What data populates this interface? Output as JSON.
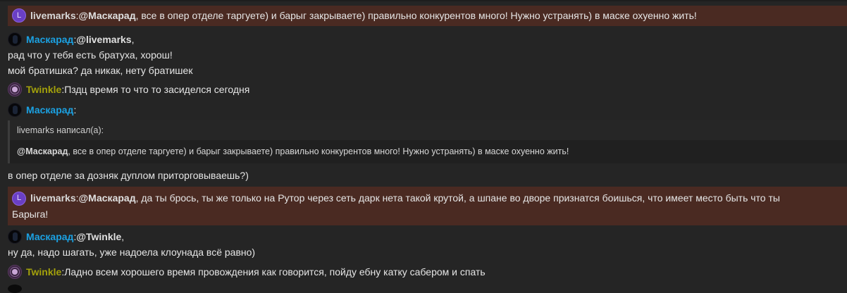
{
  "messages": [
    {
      "author": "livemarks",
      "avatar_letter": "L",
      "mention": "@Маскарад",
      "text": ", все в опер отделе таргуете) и барыг закрываете) правильно конкурентов много! Нужно устранять) в маске охуенно жить!"
    },
    {
      "author": "Маскарад",
      "mention": "@livemarks",
      "after": ",",
      "lines": [
        "рад что у тебя есть братуха, хорош!",
        "мой братишка? да никак, нету братишек"
      ]
    },
    {
      "author": "Twinkle",
      "text": "Пздц время то что то засиделся сегодня"
    },
    {
      "author": "Маскарад",
      "after": ":"
    },
    {
      "author": "livemarks",
      "avatar_letter": "L",
      "mention": "@Маскарад",
      "text_line1": ", да ты брось, ты же только на Рутор через сеть дарк нета такой крутой, а шпане во дворе признатся боишься, что имеет место быть что ты",
      "text_line2": "Барыга!"
    },
    {
      "author": "Маскарад",
      "mention": "@Twinkle",
      "after": ",",
      "lines": [
        "ну да, надо шагать, уже надоела клоунада всё равно)"
      ]
    },
    {
      "author": "Twinkle",
      "text": "Ладно всем хорошего время провождения как говорится, пойду ебну катку сабером и спать"
    }
  ],
  "quote": {
    "header": "livemarks написал(а):",
    "mention": "@Маскарад",
    "text": ", все в опер отделе таргуете) и барыг закрываете) правильно конкурентов много! Нужно устранять) в маске охуенно жить!"
  },
  "after_quote": "в опер отделе за дозняк дуплом приторговываешь?)",
  "sep": ": ",
  "colors": {
    "background": "#252525",
    "highlight": "#4a2a22",
    "maskarad": "#1ba1e2",
    "twinkle": "#a3a10b"
  }
}
